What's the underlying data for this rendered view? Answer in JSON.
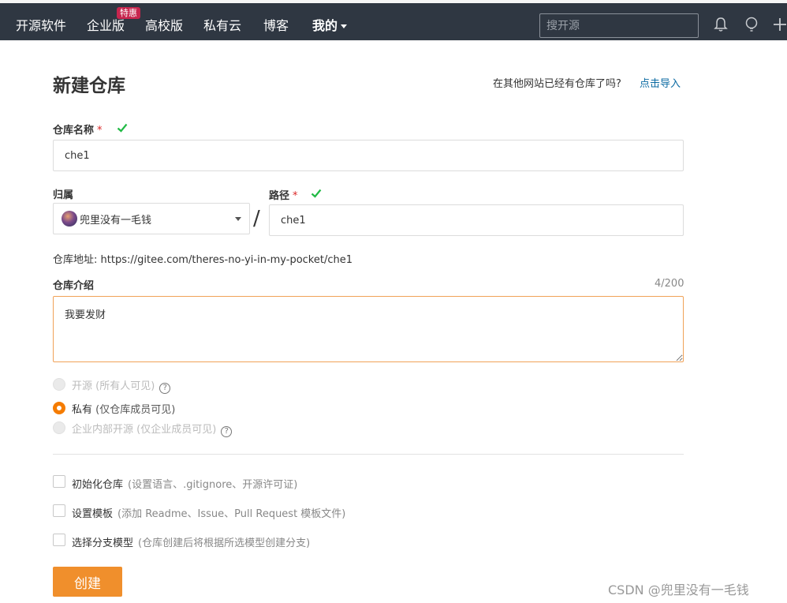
{
  "nav": {
    "items": [
      "开源软件",
      "企业版",
      "高校版",
      "私有云",
      "博客"
    ],
    "badge": "特惠",
    "mine": "我的",
    "search_placeholder": "搜开源"
  },
  "page": {
    "title": "新建仓库",
    "import_prompt": "在其他网站已经有仓库了吗?",
    "import_link": "点击导入"
  },
  "form": {
    "repo_name_label": "仓库名称",
    "repo_name_value": "che1",
    "owner_label": "归属",
    "owner_value": "兜里没有一毛钱",
    "path_label": "路径",
    "path_value": "che1",
    "required_mark": "*",
    "repo_url": "仓库地址: https://gitee.com/theres-no-yi-in-my-pocket/che1",
    "desc_label": "仓库介绍",
    "desc_counter": "4/200",
    "desc_value": "我要发财"
  },
  "visibility": [
    {
      "label": "开源",
      "hint": "(所有人可见)",
      "state": "disabled",
      "help": true
    },
    {
      "label": "私有",
      "hint": "(仅仓库成员可见)",
      "state": "checked",
      "help": false
    },
    {
      "label": "企业内部开源",
      "hint": "(仅企业成员可见)",
      "state": "disabled",
      "help": true
    }
  ],
  "options": [
    {
      "label": "初始化仓库",
      "hint": "(设置语言、.gitignore、开源许可证)"
    },
    {
      "label": "设置模板",
      "hint": "(添加 Readme、Issue、Pull Request 模板文件)"
    },
    {
      "label": "选择分支模型",
      "hint": "(仓库创建后将根据所选模型创建分支)"
    }
  ],
  "create_button": "创建",
  "watermark": "CSDN @兜里没有一毛钱",
  "colors": {
    "nav_bg": "#2f3742",
    "accent": "#f08f2c",
    "link": "#0b6aa2",
    "check_green": "#21ba45",
    "required_red": "#db2828"
  }
}
